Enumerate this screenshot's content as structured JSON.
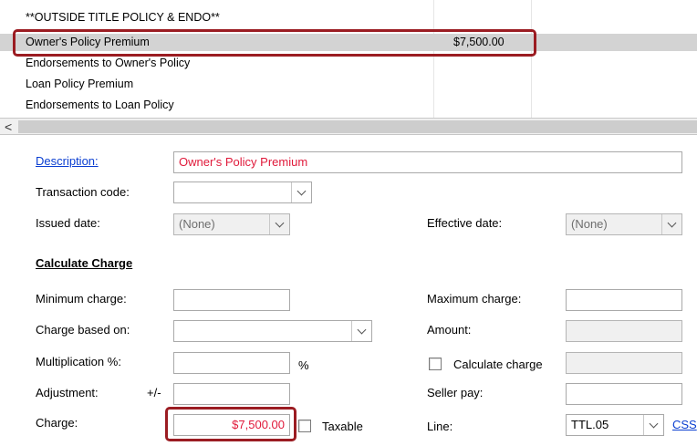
{
  "grid": {
    "rows": [
      {
        "label": "**OUTSIDE TITLE POLICY & ENDO**",
        "amount": ""
      },
      {
        "label": "Owner's Policy Premium",
        "amount": "$7,500.00"
      },
      {
        "label": "Endorsements to Owner's Policy",
        "amount": ""
      },
      {
        "label": "Loan Policy Premium",
        "amount": ""
      },
      {
        "label": "Endorsements to Loan Policy",
        "amount": ""
      }
    ],
    "scroll_left_glyph": "<"
  },
  "form": {
    "description_label": "Description:",
    "description_value": "Owner's Policy Premium",
    "transaction_code_label": "Transaction code:",
    "transaction_code_value": "",
    "issued_date_label": "Issued date:",
    "issued_date_value": "(None)",
    "effective_date_label": "Effective date:",
    "effective_date_value": "(None)",
    "calc_section_title": "Calculate Charge",
    "minimum_charge_label": "Minimum charge:",
    "minimum_charge_value": "",
    "maximum_charge_label": "Maximum charge:",
    "maximum_charge_value": "",
    "charge_based_on_label": "Charge based on:",
    "charge_based_on_value": "",
    "amount_label": "Amount:",
    "amount_value": "",
    "multiplication_label": "Multiplication %:",
    "multiplication_value": "",
    "percent_symbol": "%",
    "calculate_charge_label": "Calculate charge",
    "calculate_charge_value": "",
    "adjustment_label": "Adjustment:",
    "adjustment_sign": "+/-",
    "adjustment_value": "",
    "seller_pay_label": "Seller pay:",
    "seller_pay_value": "",
    "charge_label": "Charge:",
    "charge_value": "$7,500.00",
    "taxable_label": "Taxable",
    "line_label": "Line:",
    "line_value": "TTL.05",
    "css_link": "CSS"
  },
  "colors": {
    "highlight": "#9b1c22",
    "link": "#0a3ed1",
    "value_pink": "#e0193a",
    "selected_row": "#d3d3d3"
  }
}
